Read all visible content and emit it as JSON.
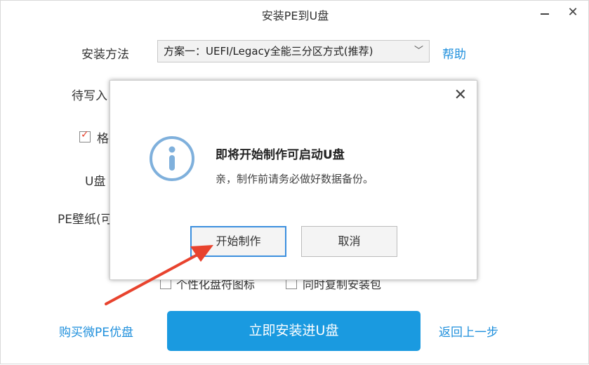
{
  "window": {
    "title": "安装PE到U盘"
  },
  "form": {
    "install_method_label": "安装方法",
    "install_method_value": "方案一：UEFI/Legacy全能三分区方式(推荐)",
    "help_link": "帮助",
    "write_label_partial": "待写入",
    "format_label_partial": "格",
    "udisk_label_partial": "U盘",
    "wallpaper_label_partial": "PE壁纸(可",
    "option_personalize_partial": "个性化盘符图标",
    "option_copy_partial": "同时复制安装包"
  },
  "footer": {
    "buy_link": "购买微PE优盘",
    "install_button": "立即安装进U盘",
    "back_link": "返回上一步"
  },
  "dialog": {
    "icon": "info-icon",
    "title": "即将开始制作可启动U盘",
    "message": "亲，制作前请务必做好数据备份。",
    "start_button": "开始制作",
    "cancel_button": "取消"
  },
  "colors": {
    "accent": "#1a9ae0",
    "link": "#1e8fdc",
    "annotation_arrow": "#e8432e"
  }
}
